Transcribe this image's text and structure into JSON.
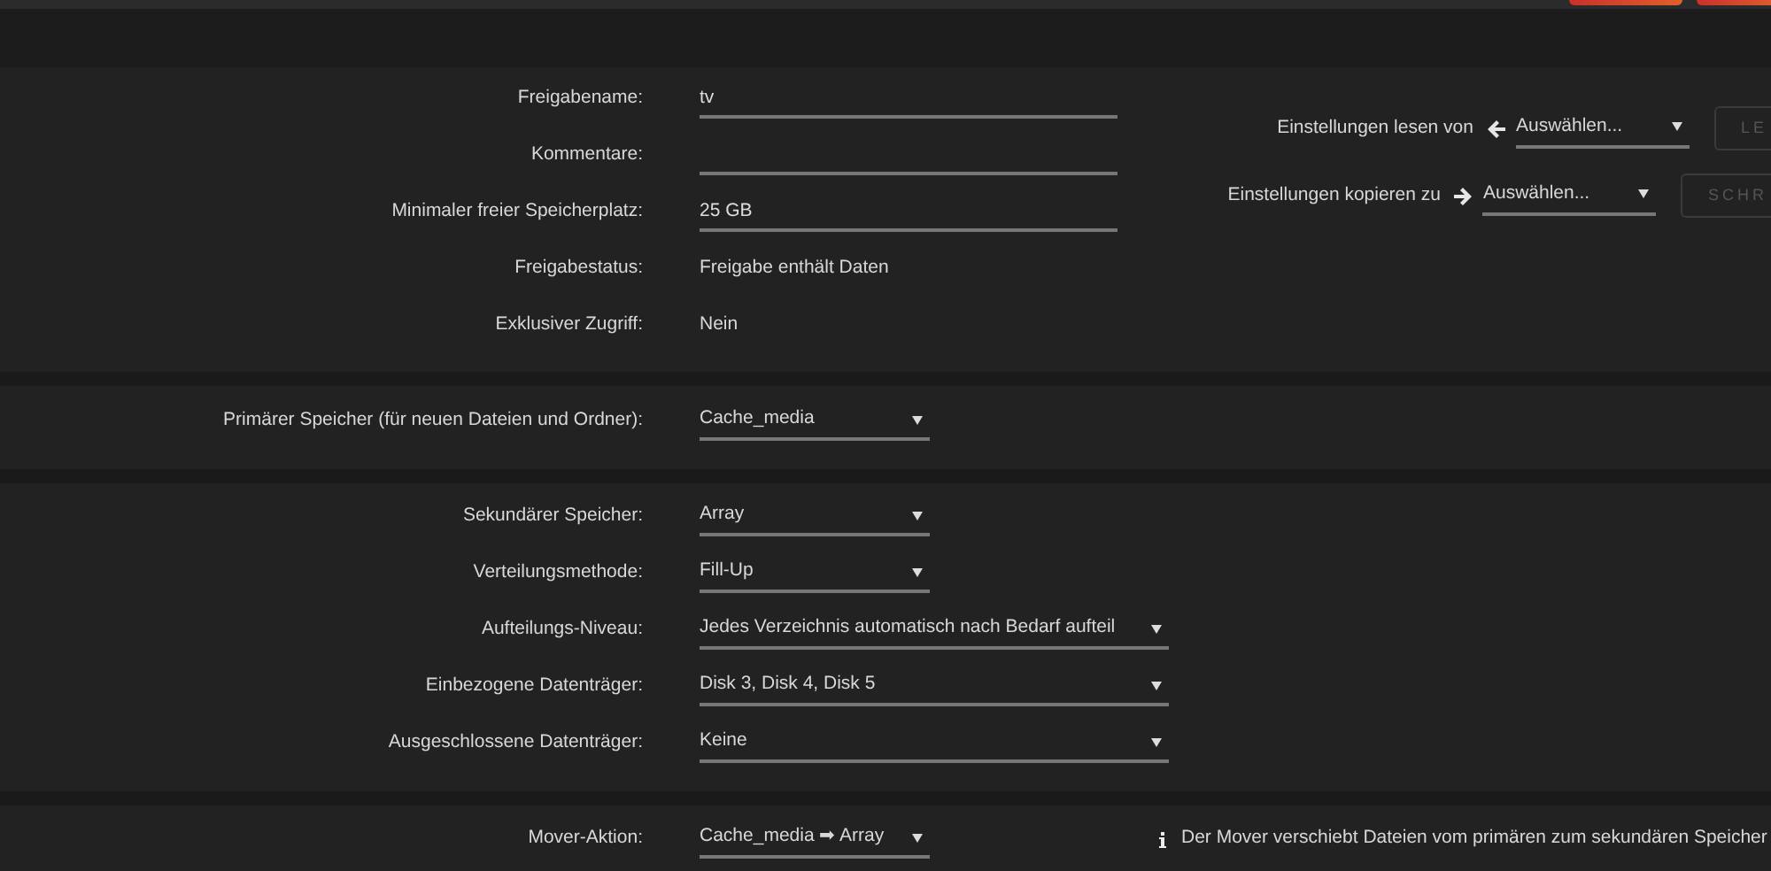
{
  "header": {
    "buttons": [
      {
        "kind": "tab"
      },
      {
        "kind": "tab"
      }
    ]
  },
  "sections": [
    {
      "rows": [
        {
          "label": "Freigabename:",
          "kind": "input",
          "value": "tv",
          "wide": true
        },
        {
          "label": "Kommentare:",
          "kind": "input",
          "value": "",
          "wide": true
        },
        {
          "label": "Minimaler freier Speicherplatz:",
          "kind": "input",
          "value": "25 GB",
          "wide": true
        },
        {
          "label": "Freigabestatus:",
          "kind": "static",
          "value": "Freigabe enthält Daten"
        },
        {
          "label": "Exklusiver Zugriff:",
          "kind": "static",
          "value": "Nein"
        }
      ],
      "side": [
        {
          "label": "Einstellungen lesen von",
          "kind": "read",
          "value": "Auswählen...",
          "button": "LE"
        },
        {
          "label": "Einstellungen kopieren zu",
          "kind": "copy",
          "value": "Auswählen...",
          "button": "SCHR"
        }
      ]
    },
    {
      "rows": [
        {
          "label": "Primärer Speicher (für neuen Dateien und Ordner):",
          "kind": "select",
          "value": "Cache_media",
          "wide": false
        }
      ]
    },
    {
      "rows": [
        {
          "label": "Sekundärer Speicher:",
          "kind": "select",
          "value": "Array",
          "wide": false
        },
        {
          "label": "Verteilungsmethode:",
          "kind": "select",
          "value": "Fill-Up",
          "wide": false
        },
        {
          "label": "Aufteilungs-Niveau:",
          "kind": "select",
          "value": "Jedes Verzeichnis automatisch nach Bedarf aufteil",
          "wide": true
        },
        {
          "label": "Einbezogene Datenträger:",
          "kind": "select",
          "value": "Disk 3, Disk 4, Disk 5",
          "wide": true
        },
        {
          "label": "Ausgeschlossene Datenträger:",
          "kind": "select",
          "value": "Keine",
          "wide": true
        }
      ]
    },
    {
      "rows": [
        {
          "label": "Mover-Aktion:",
          "kind": "select",
          "value": "Cache_media ➡ Array",
          "wide": false
        }
      ],
      "info": "Der Mover verschiebt Dateien vom primären zum sekundären Speicher"
    }
  ]
}
